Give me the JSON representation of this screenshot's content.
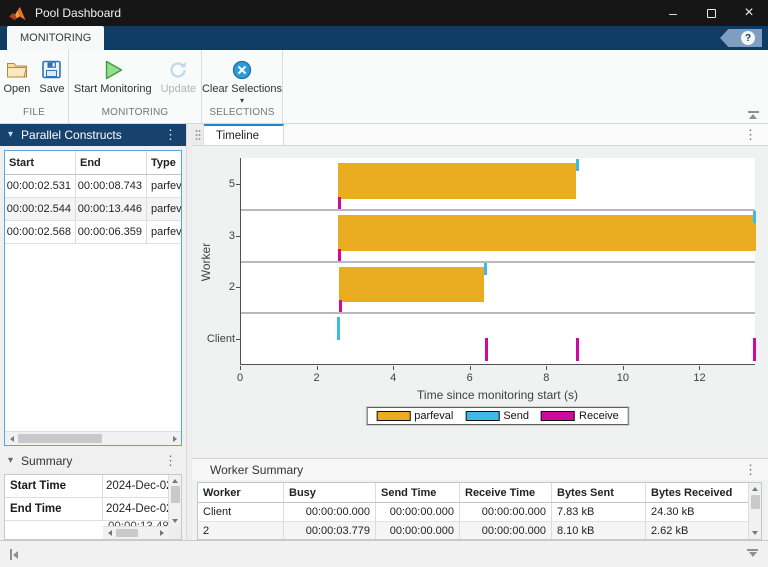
{
  "window": {
    "title": "Pool Dashboard"
  },
  "ribbon": {
    "tab": "MONITORING",
    "help": "?",
    "groups": [
      {
        "label": "FILE",
        "buttons": [
          {
            "label": "Open"
          },
          {
            "label": "Save"
          }
        ]
      },
      {
        "label": "MONITORING",
        "buttons": [
          {
            "label": "Start Monitoring"
          },
          {
            "label": "Update",
            "disabled": true
          }
        ]
      },
      {
        "label": "SELECTIONS",
        "buttons": [
          {
            "label": "Clear Selections",
            "has_dropdown": true
          }
        ]
      }
    ]
  },
  "parallel_constructs": {
    "title": "Parallel Constructs",
    "columns": [
      "Start",
      "End",
      "Type"
    ],
    "rows": [
      [
        "00:00:02.531",
        "00:00:08.743",
        "parfeval"
      ],
      [
        "00:00:02.544",
        "00:00:13.446",
        "parfeval"
      ],
      [
        "00:00:02.568",
        "00:00:06.359",
        "parfeval"
      ]
    ]
  },
  "summary": {
    "title": "Summary",
    "rows": [
      {
        "label": "Start Time",
        "value": "2024-Dec-02"
      },
      {
        "label": "End Time",
        "value": "2024-Dec-02"
      }
    ],
    "partial_value": "00:00:13.48"
  },
  "timeline_panel": {
    "tab": "Timeline"
  },
  "worker_summary": {
    "title": "Worker Summary",
    "columns": [
      "Worker",
      "Busy",
      "Send Time",
      "Receive Time",
      "Bytes Sent",
      "Bytes Received"
    ],
    "rows": [
      [
        "Client",
        "00:00:00.000",
        "00:00:00.000",
        "00:00:00.000",
        "7.83 kB",
        "24.30 kB"
      ],
      [
        "2",
        "00:00:03.779",
        "00:00:00.000",
        "00:00:00.000",
        "8.10 kB",
        "2.62 kB"
      ]
    ]
  },
  "chart_data": {
    "type": "timeline-gantt",
    "title": "",
    "xlabel": "Time since monitoring start (s)",
    "ylabel": "Worker",
    "xlim": [
      0,
      13.45
    ],
    "xticks": [
      0,
      2,
      4,
      6,
      8,
      10,
      12
    ],
    "lanes": [
      "5",
      "3",
      "2",
      "Client"
    ],
    "grid": false,
    "legend_position": "bottom-center",
    "series": [
      {
        "name": "parfeval",
        "kind": "bar",
        "color": "#EAAD21",
        "bars": [
          {
            "lane": "5",
            "start": 2.531,
            "end": 8.743
          },
          {
            "lane": "3",
            "start": 2.544,
            "end": 13.446
          },
          {
            "lane": "2",
            "start": 2.568,
            "end": 6.359
          }
        ]
      },
      {
        "name": "Send",
        "kind": "tick",
        "color": "#3FB9E6",
        "events": [
          {
            "lane": "5",
            "t": 8.743
          },
          {
            "lane": "3",
            "t": 13.446
          },
          {
            "lane": "2",
            "t": 6.359
          },
          {
            "lane": "Client",
            "t": 2.5
          }
        ]
      },
      {
        "name": "Receive",
        "kind": "tick",
        "color": "#CE0B9E",
        "events": [
          {
            "lane": "5",
            "t": 2.531
          },
          {
            "lane": "3",
            "t": 2.544
          },
          {
            "lane": "2",
            "t": 2.568
          },
          {
            "lane": "Client",
            "t": 6.36
          },
          {
            "lane": "Client",
            "t": 8.75
          },
          {
            "lane": "Client",
            "t": 13.45
          }
        ]
      }
    ],
    "colors": {
      "parfeval": "#EAAD21",
      "send": "#3FB9E6",
      "receive": "#CE0B9E"
    }
  }
}
